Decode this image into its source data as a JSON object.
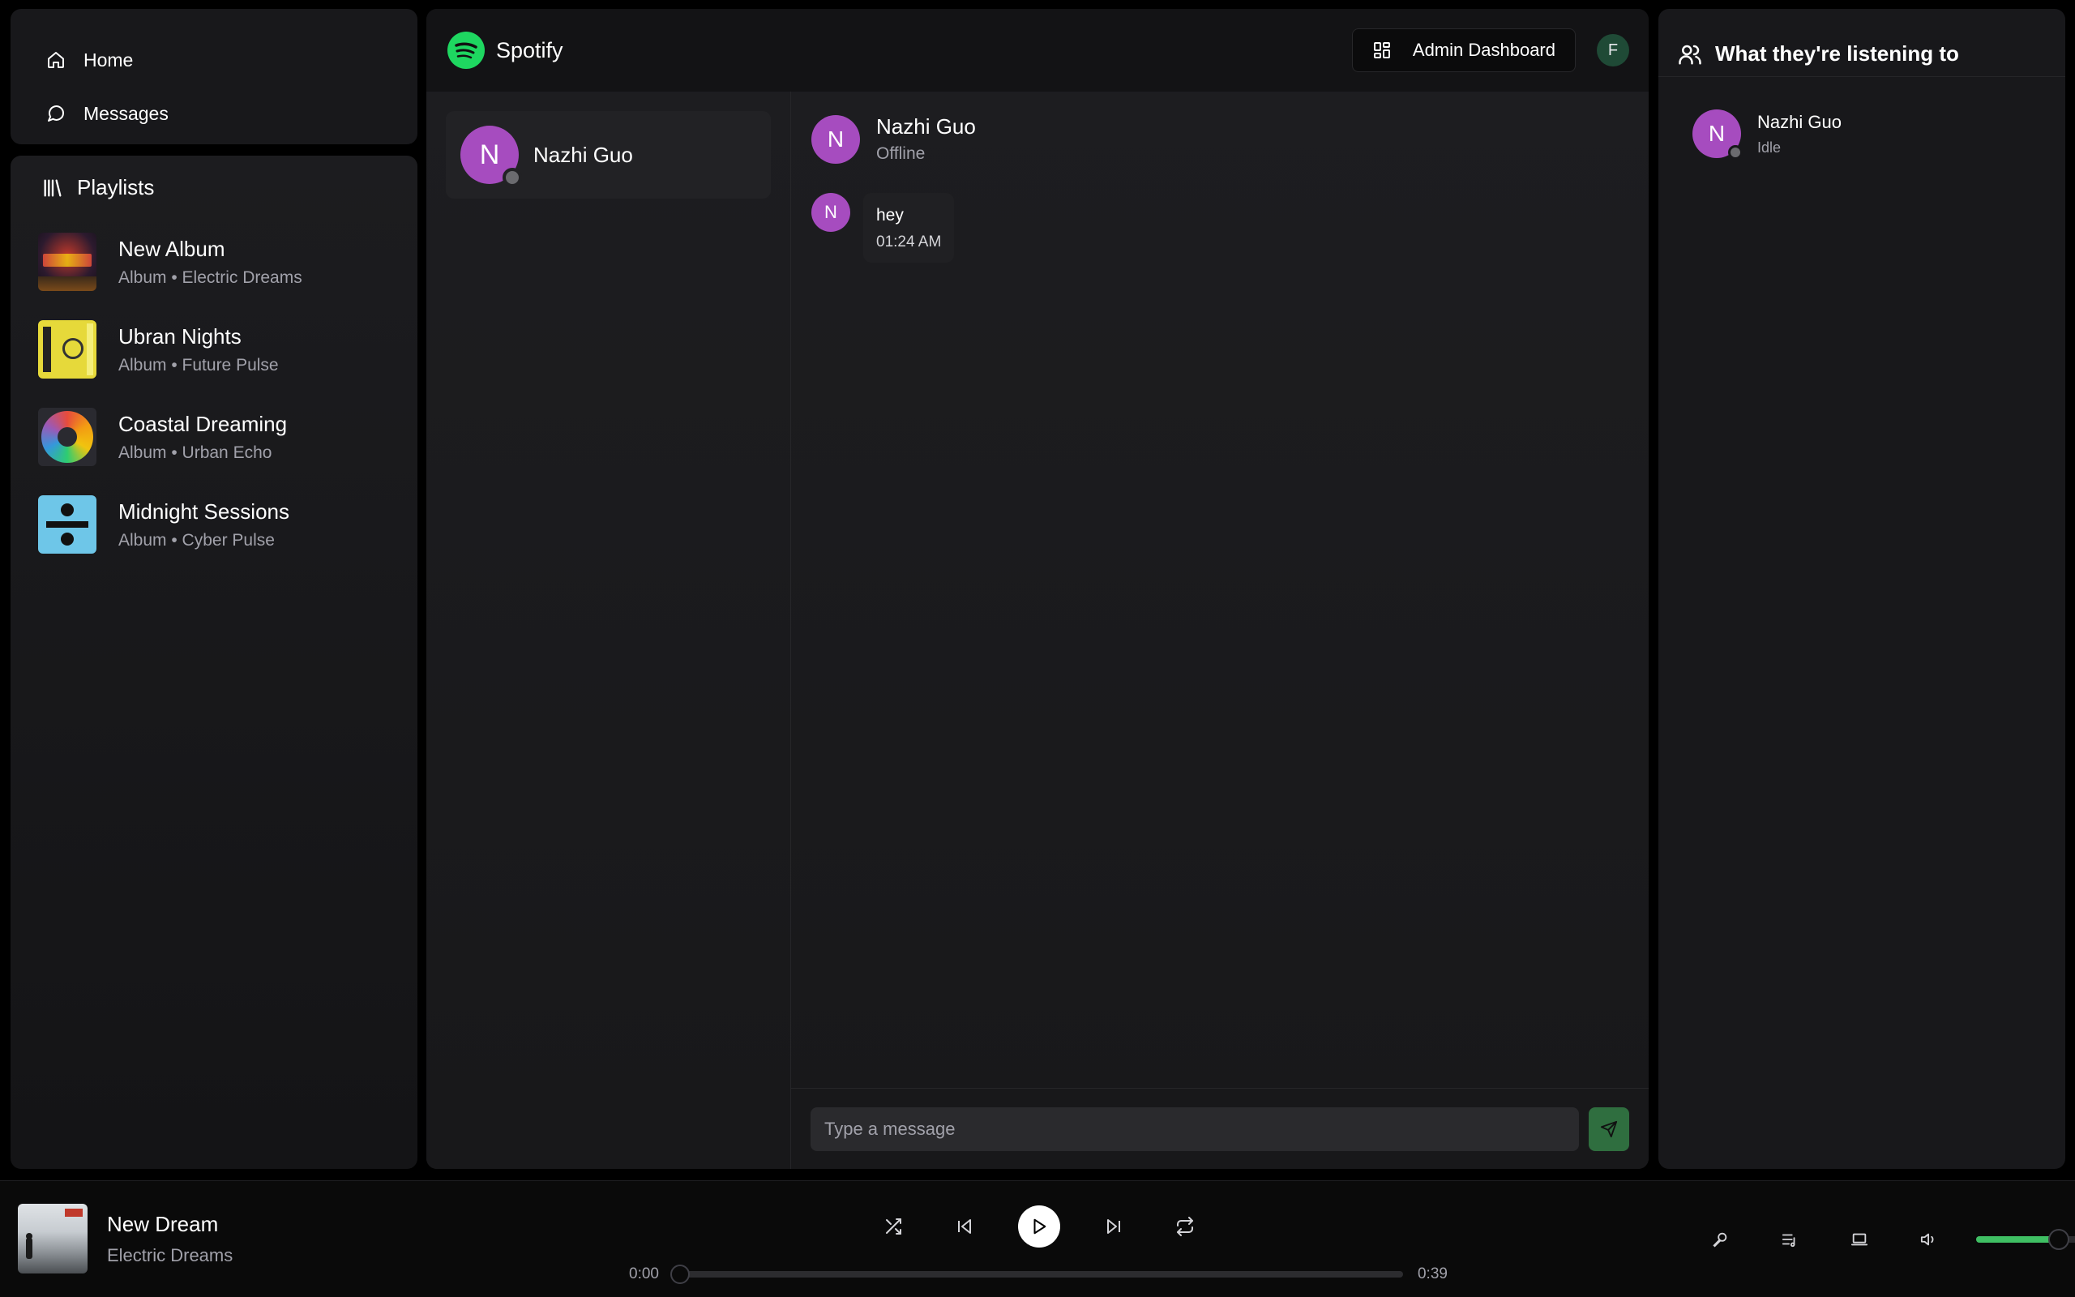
{
  "nav": {
    "home": "Home",
    "messages": "Messages"
  },
  "playlists": {
    "header": "Playlists",
    "items": [
      {
        "title": "New Album",
        "subtitle": "Album • Electric Dreams"
      },
      {
        "title": "Ubran Nights",
        "subtitle": "Album • Future Pulse"
      },
      {
        "title": "Coastal Dreaming",
        "subtitle": "Album • Urban Echo"
      },
      {
        "title": "Midnight Sessions",
        "subtitle": "Album • Cyber Pulse"
      }
    ]
  },
  "header": {
    "brand": "Spotify",
    "admin_label": "Admin Dashboard",
    "user_initial": "F"
  },
  "chat": {
    "users": [
      {
        "initial": "N",
        "name": "Nazhi Guo"
      }
    ],
    "active": {
      "initial": "N",
      "name": "Nazhi Guo",
      "status": "Offline"
    },
    "messages": [
      {
        "initial": "N",
        "text": "hey",
        "time": "01:24 AM"
      }
    ],
    "input_placeholder": "Type a message"
  },
  "friends": {
    "header": "What they're listening to",
    "items": [
      {
        "initial": "N",
        "name": "Nazhi Guo",
        "status": "Idle"
      }
    ]
  },
  "player": {
    "title": "New Dream",
    "artist": "Electric Dreams",
    "current_time": "0:00",
    "duration": "0:39",
    "progress": 0,
    "volume": 0.7
  },
  "colors": {
    "accent": "#1ed760",
    "avatar": "#a64cbf",
    "send_button": "#2f6e3f",
    "volume_fill": "#3fbf63"
  }
}
